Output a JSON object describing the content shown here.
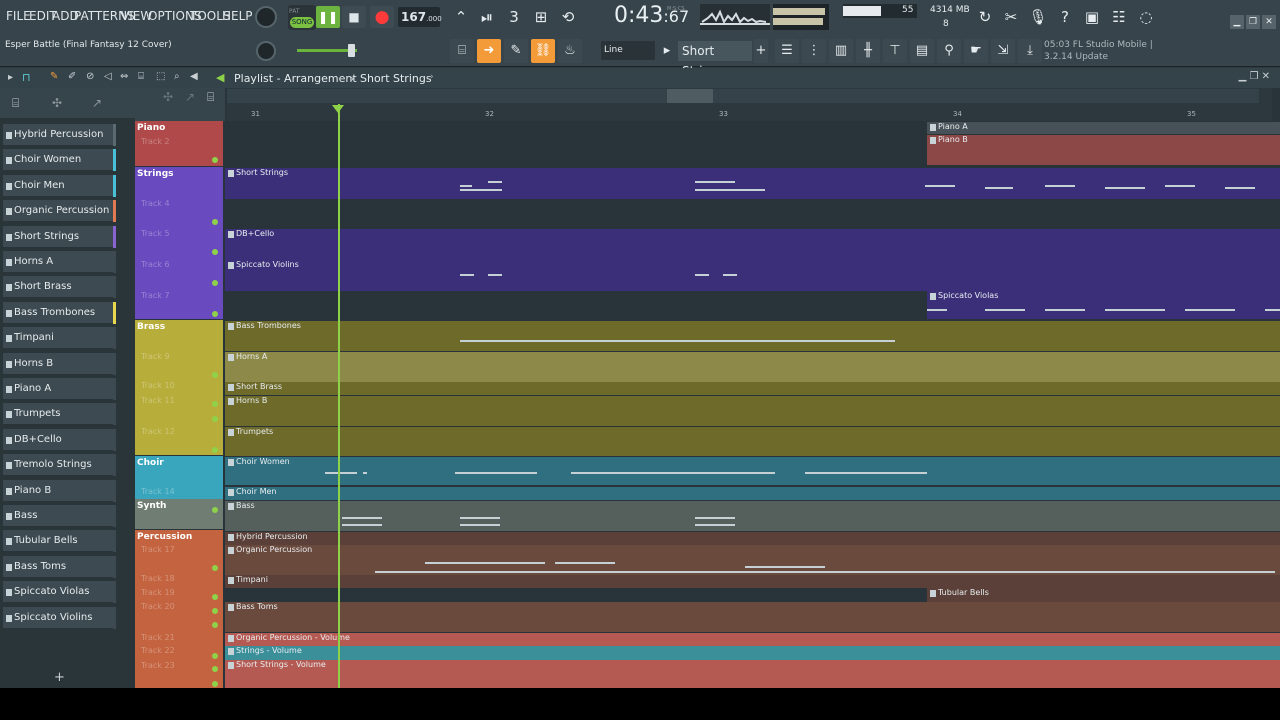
{
  "menu": [
    "FILE",
    "EDIT",
    "ADD",
    "PATTERNS",
    "VIEW",
    "OPTIONS",
    "TOOLS",
    "HELP"
  ],
  "project": {
    "title": "Esper Battle (Final Fantasy 12 Cover)"
  },
  "transport": {
    "pat_label": "PAT",
    "song_label": "SONG",
    "tempo": "167",
    "tempo_decimals": ".000",
    "time_main": "0:43",
    "time_sub": ":67",
    "time_unit": "M:S:CS"
  },
  "stats": {
    "cpu": "55",
    "ram": "4314 MB",
    "polyphony": "8"
  },
  "toolbar2": {
    "snap": "Line",
    "channel": "Short Strings",
    "hint_line1": "05:03  FL Studio Mobile |",
    "hint_line2": "3.2.14 Update"
  },
  "playlist": {
    "title": "Playlist - Arrangement",
    "pattern": "Short Strings"
  },
  "ruler": [
    "31",
    "32",
    "33",
    "34",
    "35"
  ],
  "browser": [
    {
      "label": "Hybrid Percussion",
      "color": "#5a6a70"
    },
    {
      "label": "Choir Women",
      "color": "#49c0d8"
    },
    {
      "label": "Choir Men",
      "color": "#49c0d8"
    },
    {
      "label": "Organic Percussion",
      "color": "#e07a50"
    },
    {
      "label": "Short Strings",
      "color": "#8a63d2"
    },
    {
      "label": "Horns A",
      "color": "#3d4a51"
    },
    {
      "label": "Short Brass",
      "color": "#3d4a51"
    },
    {
      "label": "Bass Trombones",
      "color": "#e8d84f"
    },
    {
      "label": "Timpani",
      "color": "#3d4a51"
    },
    {
      "label": "Horns B",
      "color": "#3d4a51"
    },
    {
      "label": "Piano A",
      "color": "#3d4a51"
    },
    {
      "label": "Trumpets",
      "color": "#3d4a51"
    },
    {
      "label": "DB+Cello",
      "color": "#3d4a51"
    },
    {
      "label": "Tremolo Strings",
      "color": "#3d4a51"
    },
    {
      "label": "Piano B",
      "color": "#3d4a51"
    },
    {
      "label": "Bass",
      "color": "#3d4a51"
    },
    {
      "label": "Tubular Bells",
      "color": "#3d4a51"
    },
    {
      "label": "Bass Toms",
      "color": "#3d4a51"
    },
    {
      "label": "Spiccato Violas",
      "color": "#3d4a51"
    },
    {
      "label": "Spiccato Violins",
      "color": "#3d4a51"
    }
  ],
  "groups": [
    {
      "name": "Piano",
      "color": "#b04a4a"
    },
    {
      "name": "Strings",
      "color": "#6a4bbf"
    },
    {
      "name": "Brass",
      "color": "#b7ad3a"
    },
    {
      "name": "Choir",
      "color": "#3aa6bd"
    },
    {
      "name": "Synth",
      "color": "#6f7d72"
    },
    {
      "name": "Percussion",
      "color": "#c4633f"
    }
  ],
  "tracks": [
    "Track 2",
    "Track 4",
    "Track 5",
    "Track 6",
    "Track 7",
    "Track 9",
    "Track 10",
    "Track 11",
    "Track 12",
    "Track 14",
    "Track 17",
    "Track 18",
    "Track 19",
    "Track 20",
    "Track 21",
    "Track 22",
    "Track 23"
  ],
  "clips": {
    "piano_a": "Piano A",
    "piano_b": "Piano B",
    "short_strings": "Short Strings",
    "db_cello": "DB+Cello",
    "spiccato_violins": "Spiccato Violins",
    "spiccato_violas": "Spiccato Violas",
    "bass_trombones": "Bass Trombones",
    "horns_a": "Horns A",
    "short_brass": "Short Brass",
    "horns_b": "Horns B",
    "trumpets": "Trumpets",
    "choir_women": "Choir Women",
    "choir_men": "Choir Men",
    "bass": "Bass",
    "hybrid_percussion": "Hybrid Percussion",
    "organic_percussion": "Organic Percussion",
    "timpani": "Timpani",
    "tubular_bells": "Tubular Bells",
    "bass_toms": "Bass Toms",
    "auto_organic": "Organic Percussion - Volume",
    "auto_strings": "Strings - Volume",
    "auto_short_strings": "Short Strings - Volume"
  }
}
